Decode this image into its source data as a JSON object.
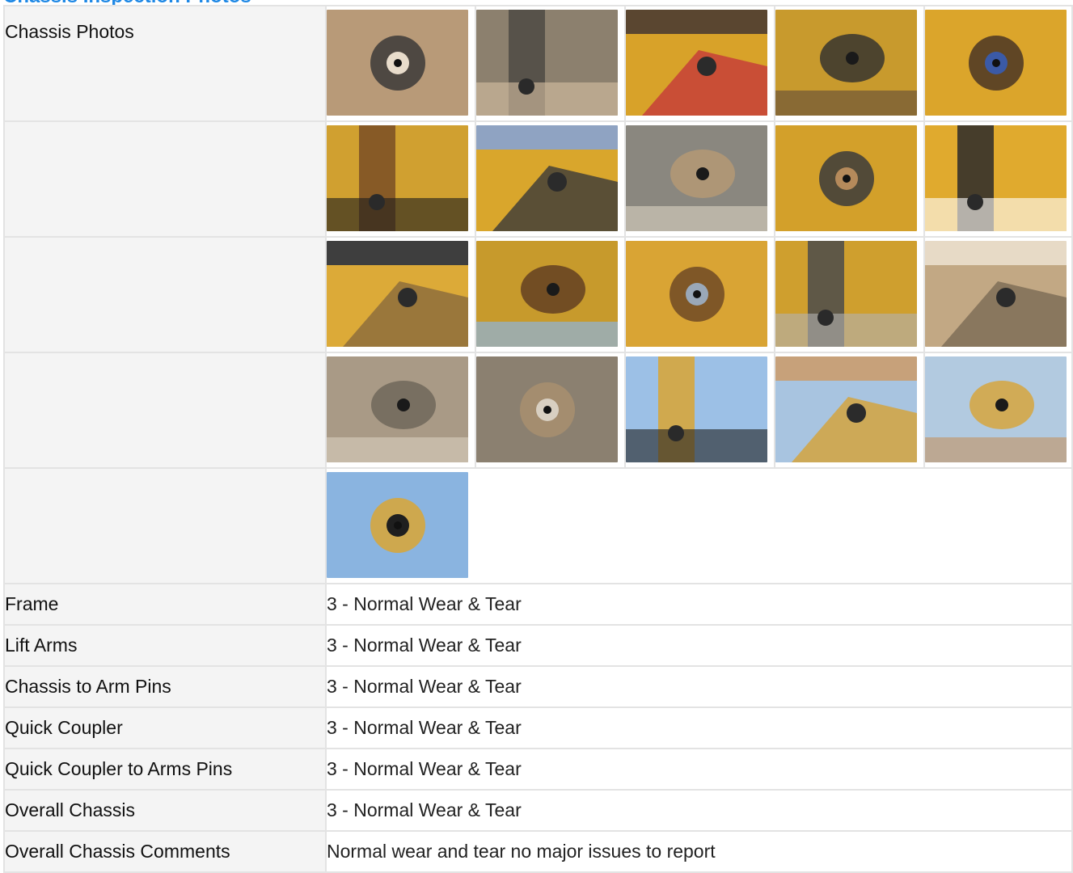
{
  "section": {
    "title": "Chassis Inspection Photos"
  },
  "photo_rows": [
    {
      "label": "Chassis Photos",
      "photos": [
        {
          "alt": "pin-closeup-dirt",
          "bg": "#b89a78",
          "fg": "#3b3a38",
          "accent": "#e8dccb"
        },
        {
          "alt": "arm-joint-dusty",
          "bg": "#8c806e",
          "fg": "#4d4a44",
          "accent": "#d7c2a4"
        },
        {
          "alt": "red-bracket-pin",
          "bg": "#d8a229",
          "fg": "#c53a3a",
          "accent": "#5a4630"
        },
        {
          "alt": "arm-hinge-rust",
          "bg": "#c89a2d",
          "fg": "#2e2e2e",
          "accent": "#6e5638"
        },
        {
          "alt": "pin-with-flag-sticker",
          "bg": "#dba52b",
          "fg": "#4a3524",
          "accent": "#3b5aa6"
        }
      ]
    },
    {
      "label": "",
      "photos": [
        {
          "alt": "rusty-pin-closeup",
          "bg": "#d0a030",
          "fg": "#7a4e25",
          "accent": "#1c1c1c"
        },
        {
          "alt": "cylinder-base",
          "bg": "#d9a62c",
          "fg": "#3a3a3a",
          "accent": "#8fa3c2"
        },
        {
          "alt": "dusty-pin-arm",
          "bg": "#8a877f",
          "fg": "#b79a74",
          "accent": "#cfc7b8"
        },
        {
          "alt": "cylinder-mount-dirt",
          "bg": "#d3a02a",
          "fg": "#3b3b3b",
          "accent": "#b58a5b"
        },
        {
          "alt": "empire-logo-pin",
          "bg": "#e0aa2e",
          "fg": "#2a2a2a",
          "accent": "#ffffff"
        }
      ]
    },
    {
      "label": "",
      "photos": [
        {
          "alt": "pin-near-cab",
          "bg": "#dcaa38",
          "fg": "#8a6a3c",
          "accent": "#3e3e3e"
        },
        {
          "alt": "arm-rust-sky",
          "bg": "#c79a2c",
          "fg": "#5c3a22",
          "accent": "#8fb4dc"
        },
        {
          "alt": "pin-bracket-rust",
          "bg": "#d9a434",
          "fg": "#6e4a26",
          "accent": "#9aa8b8"
        },
        {
          "alt": "hydraulic-lines-pin",
          "bg": "#cf9f2e",
          "fg": "#4b4b4b",
          "accent": "#b2b2b2"
        },
        {
          "alt": "cylinder-joint-dusty",
          "bg": "#c2a884",
          "fg": "#7b6a55",
          "accent": "#e7dac6"
        }
      ]
    },
    {
      "label": "",
      "photos": [
        {
          "alt": "coupler-dirt-clump",
          "bg": "#a99a86",
          "fg": "#6c6458",
          "accent": "#d3c8b7"
        },
        {
          "alt": "coupler-pin-mud",
          "bg": "#8b8070",
          "fg": "#a88f6e",
          "accent": "#d8cfc1"
        },
        {
          "alt": "machine-side-cab",
          "bg": "#9cc0e6",
          "fg": "#d9a432",
          "accent": "#202020"
        },
        {
          "alt": "machine-tracks-front",
          "bg": "#a8c4e0",
          "fg": "#d6a234",
          "accent": "#c7a17a"
        },
        {
          "alt": "machine-tracks-side",
          "bg": "#b2cae0",
          "fg": "#d8a333",
          "accent": "#c09a72"
        }
      ]
    },
    {
      "label": "",
      "photos": [
        {
          "alt": "machine-side-289c",
          "bg": "#8ab4e0",
          "fg": "#d9a634",
          "accent": "#1f1f1f"
        }
      ]
    }
  ],
  "rows": [
    {
      "label": "Frame",
      "value": "3 - Normal Wear & Tear"
    },
    {
      "label": "Lift Arms",
      "value": "3 - Normal Wear & Tear"
    },
    {
      "label": "Chassis to Arm Pins",
      "value": "3 - Normal Wear & Tear"
    },
    {
      "label": "Quick Coupler",
      "value": "3 - Normal Wear & Tear"
    },
    {
      "label": "Quick Coupler to Arms Pins",
      "value": "3 - Normal Wear & Tear"
    },
    {
      "label": "Overall Chassis",
      "value": "3 - Normal Wear & Tear"
    },
    {
      "label": "Overall Chassis Comments",
      "value": "Normal wear and tear no major issues to report"
    }
  ]
}
